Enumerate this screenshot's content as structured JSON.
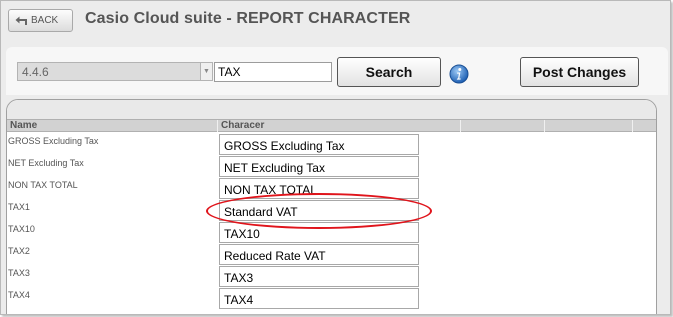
{
  "header": {
    "back_label": "BACK",
    "title": "Casio Cloud suite - REPORT CHARACTER"
  },
  "toolbar": {
    "version_value": "4.4.6",
    "search_value": "TAX",
    "search_label": "Search",
    "post_label": "Post Changes"
  },
  "table": {
    "columns": [
      "Name",
      "Characer",
      "",
      "",
      ""
    ],
    "rows": [
      {
        "name": "GROSS Excluding Tax",
        "value": "GROSS Excluding Tax"
      },
      {
        "name": "NET Excluding Tax",
        "value": "NET Excluding Tax"
      },
      {
        "name": "NON TAX TOTAL",
        "value": "NON TAX TOTAL"
      },
      {
        "name": "TAX1",
        "value": "Standard VAT"
      },
      {
        "name": "TAX10",
        "value": "TAX10"
      },
      {
        "name": "TAX2",
        "value": "Reduced Rate VAT"
      },
      {
        "name": "TAX3",
        "value": "TAX3"
      },
      {
        "name": "TAX4",
        "value": "TAX4"
      }
    ]
  },
  "colors": {
    "highlight": "#e0141b",
    "info_icon": "#2d74c8"
  },
  "icons": [
    "back-arrow-icon",
    "dropdown-arrow-icon",
    "info-icon"
  ]
}
